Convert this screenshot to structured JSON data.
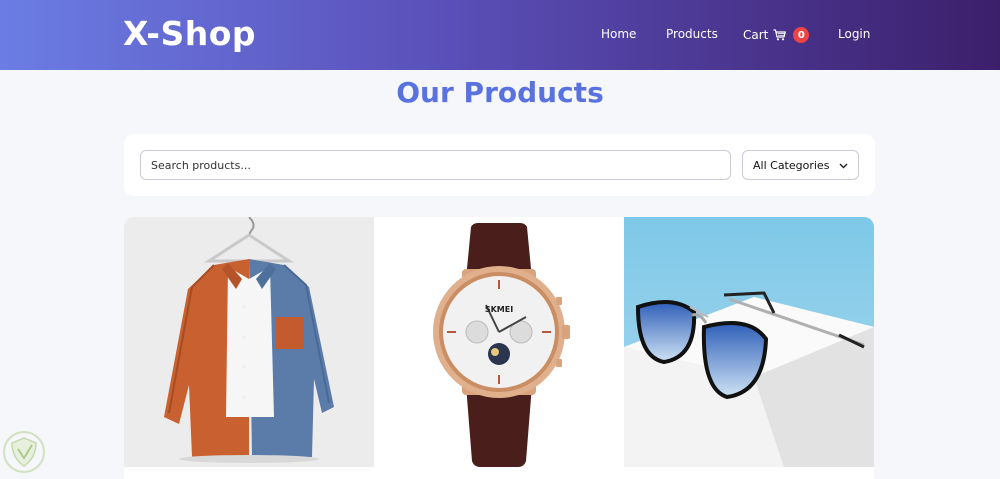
{
  "header": {
    "logo": "X-Shop",
    "nav": {
      "home": "Home",
      "products": "Products",
      "cart": "Cart",
      "cart_count": "0",
      "login": "Login"
    }
  },
  "main": {
    "title": "Our Products",
    "search": {
      "placeholder": "Search products...",
      "value": ""
    },
    "category_filter": {
      "selected": "All Categories"
    },
    "products": [
      {
        "image": "shirt-image",
        "alt": "Orange and blue corduroy shirt on hanger"
      },
      {
        "image": "watch-image",
        "alt": "Rose gold chronograph watch with brown strap"
      },
      {
        "image": "sunglasses-image",
        "alt": "Blue lens aviator sunglasses on white block"
      }
    ]
  },
  "colors": {
    "nav_gradient_start": "#6b7de4",
    "nav_gradient_end": "#3c1f6b",
    "title": "#5a72e0",
    "badge": "#ef4444",
    "page_background": "#f5f7fa"
  }
}
